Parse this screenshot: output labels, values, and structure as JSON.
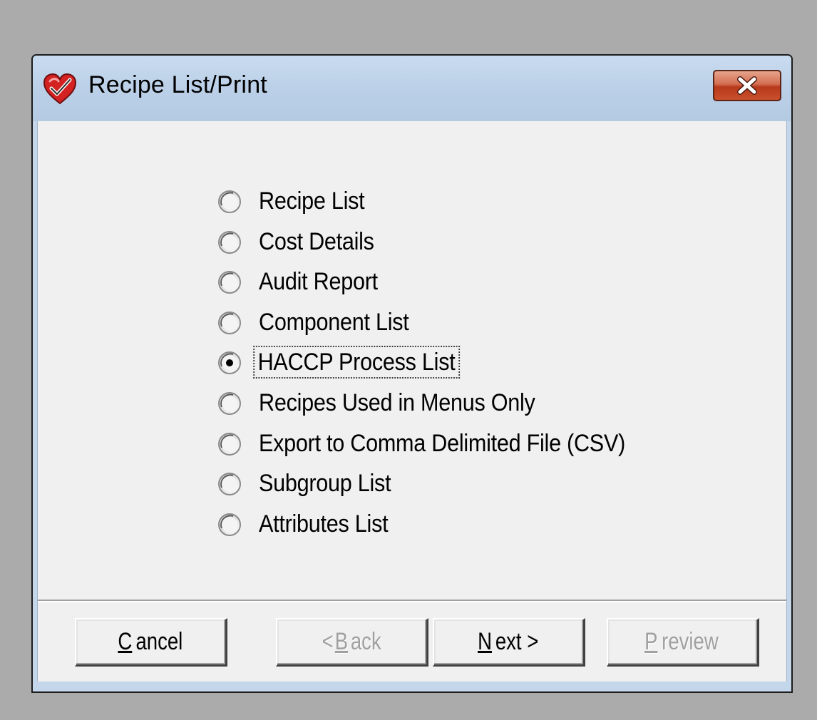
{
  "window": {
    "title": "Recipe List/Print",
    "icon": "heart-check-icon",
    "close_icon": "close-icon"
  },
  "options": [
    {
      "label": "Recipe List",
      "selected": false
    },
    {
      "label": "Cost Details",
      "selected": false
    },
    {
      "label": "Audit Report",
      "selected": false
    },
    {
      "label": "Component List",
      "selected": false
    },
    {
      "label": "HACCP Process List",
      "selected": true
    },
    {
      "label": "Recipes Used in Menus Only",
      "selected": false
    },
    {
      "label": "Export to Comma Delimited File (CSV)",
      "selected": false
    },
    {
      "label": "Subgroup List",
      "selected": false
    },
    {
      "label": "Attributes List",
      "selected": false
    }
  ],
  "buttons": {
    "cancel": {
      "label": "Cancel",
      "mnemonic": "C",
      "rest": "ancel",
      "enabled": true
    },
    "back": {
      "label": "< Back",
      "prefix": "< ",
      "mnemonic": "B",
      "rest": "ack",
      "enabled": false
    },
    "next": {
      "label": "Next >",
      "mnemonic": "N",
      "rest": "ext >",
      "enabled": true
    },
    "preview": {
      "label": "Preview",
      "mnemonic": "P",
      "rest": "review",
      "enabled": false
    }
  },
  "colors": {
    "titlebar": "#bcd1e8",
    "client": "#f0f0f0",
    "close_button": "#c9502c",
    "heart": "#d42121"
  }
}
